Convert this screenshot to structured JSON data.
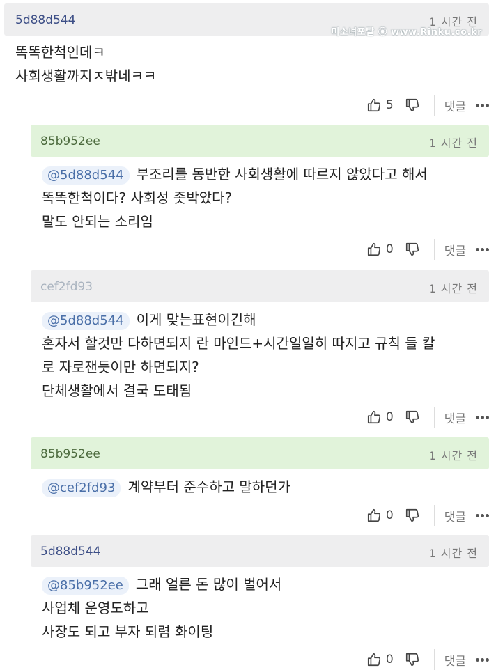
{
  "watermark": "미소녀포탈 ⦿ www.Rinku.co.kr",
  "ui": {
    "reply_label": "댓글"
  },
  "comments": [
    {
      "author": "5d88d544",
      "time": "1 시간 전",
      "lines": [
        "똑똑한척인데ㅋ",
        "사회생활까지ㅈ밖네ㅋㅋ"
      ],
      "likes": "5"
    },
    {
      "author": "85b952ee",
      "time": "1 시간 전",
      "mention": "@5d88d544",
      "lines": [
        "부조리를 동반한 사회생활에 따르지 않았다고 해서",
        "똑똑한척이다? 사회성 좃박았다?",
        "말도 안되는 소리임"
      ],
      "likes": "0"
    },
    {
      "author": "cef2fd93",
      "time": "1 시간 전",
      "mention": "@5d88d544",
      "lines": [
        "이게 맞는표현이긴해",
        "혼자서 할것만 다하면되지 란 마인드+시간일일히 따지고 규칙 들 칼",
        "로 자로잰듯이만 하면되지?",
        "단체생활에서 결국 도태됨"
      ],
      "likes": "0"
    },
    {
      "author": "85b952ee",
      "time": "1 시간 전",
      "mention": "@cef2fd93",
      "lines": [
        "계약부터 준수하고 말하던가"
      ],
      "likes": "0"
    },
    {
      "author": "5d88d544",
      "time": "1 시간 전",
      "mention": "@85b952ee",
      "lines": [
        "그래 얼른 돈 많이 벌어서",
        "사업체 운영도하고",
        "사장도 되고 부자 되렴 화이팅"
      ],
      "likes": "0"
    }
  ]
}
